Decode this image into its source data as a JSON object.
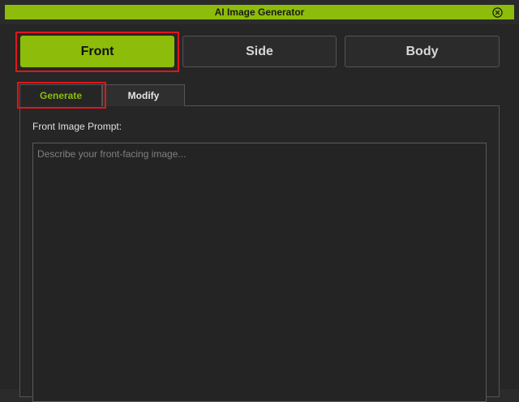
{
  "window": {
    "title": "AI Image Generator",
    "close_icon": "close-circle-icon"
  },
  "mode_buttons": [
    {
      "label": "Front",
      "active": true
    },
    {
      "label": "Side",
      "active": false
    },
    {
      "label": "Body",
      "active": false
    }
  ],
  "tabs": [
    {
      "label": "Generate",
      "active": true
    },
    {
      "label": "Modify",
      "active": false
    }
  ],
  "prompt": {
    "label": "Front Image Prompt:",
    "placeholder": "Describe your front-facing image...",
    "value": ""
  },
  "colors": {
    "accent": "#8dbd0a",
    "highlight": "#e0161c",
    "background": "#262626"
  }
}
